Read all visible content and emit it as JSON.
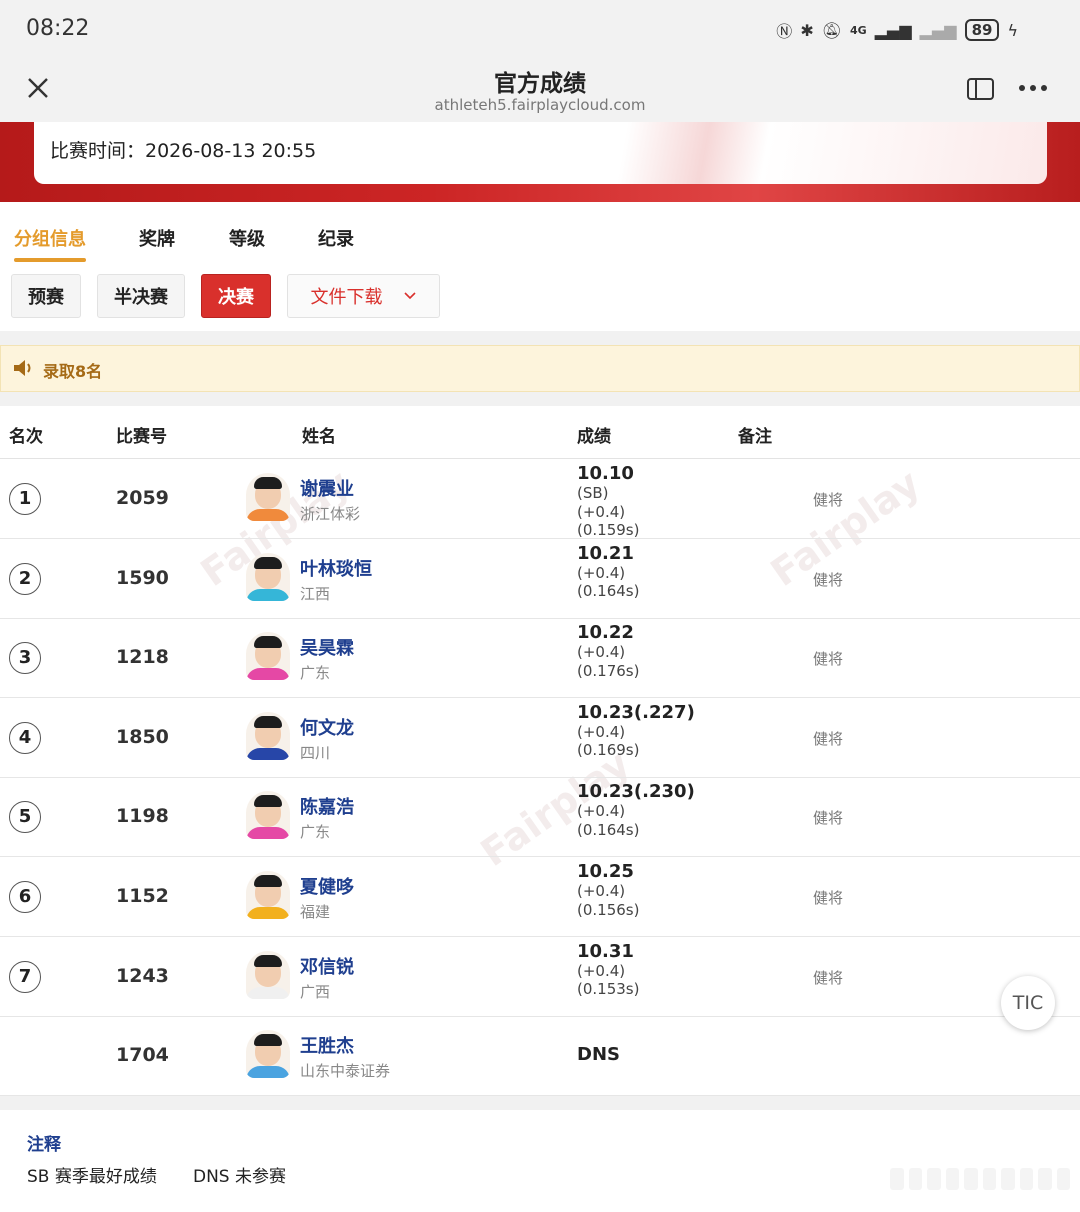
{
  "status_bar": {
    "time": "08:22",
    "network": "4G",
    "battery": "89"
  },
  "browser": {
    "title": "官方成绩",
    "url": "athleteh5.fairplaycloud.com"
  },
  "match_info": {
    "time_label": "比赛时间：2026-08-13  20:55"
  },
  "tabs": [
    {
      "label": "分组信息",
      "active": true
    },
    {
      "label": "奖牌",
      "active": false
    },
    {
      "label": "等级",
      "active": false
    },
    {
      "label": "纪录",
      "active": false
    }
  ],
  "rounds": [
    {
      "label": "预赛",
      "active": false
    },
    {
      "label": "半决赛",
      "active": false
    },
    {
      "label": "决赛",
      "active": true
    }
  ],
  "download_label": "文件下载",
  "notice": "录取8名",
  "table": {
    "headers": [
      "名次",
      "比赛号",
      "姓名",
      "成绩",
      "备注"
    ],
    "rows": [
      {
        "rank": "1",
        "bib": "2059",
        "name": "谢震业",
        "team": "浙江体彩",
        "mark": "10.10",
        "sub": [
          "(SB)",
          "(+0.4)",
          "(0.159s)"
        ],
        "note": "健将",
        "shirt": "#f08a3c"
      },
      {
        "rank": "2",
        "bib": "1590",
        "name": "叶林琰恒",
        "team": "江西",
        "mark": "10.21",
        "sub": [
          "(+0.4)",
          "(0.164s)"
        ],
        "note": "健将",
        "shirt": "#35b6d8"
      },
      {
        "rank": "3",
        "bib": "1218",
        "name": "吴昊霖",
        "team": "广东",
        "mark": "10.22",
        "sub": [
          "(+0.4)",
          "(0.176s)"
        ],
        "note": "健将",
        "shirt": "#e548a5"
      },
      {
        "rank": "4",
        "bib": "1850",
        "name": "何文龙",
        "team": "四川",
        "mark": "10.23(.227)",
        "sub": [
          "(+0.4)",
          "(0.169s)"
        ],
        "note": "健将",
        "shirt": "#2746a8"
      },
      {
        "rank": "5",
        "bib": "1198",
        "name": "陈嘉浩",
        "team": "广东",
        "mark": "10.23(.230)",
        "sub": [
          "(+0.4)",
          "(0.164s)"
        ],
        "note": "健将",
        "shirt": "#e548a5"
      },
      {
        "rank": "6",
        "bib": "1152",
        "name": "夏健哆",
        "team": "福建",
        "mark": "10.25",
        "sub": [
          "(+0.4)",
          "(0.156s)"
        ],
        "note": "健将",
        "shirt": "#f2b01e"
      },
      {
        "rank": "7",
        "bib": "1243",
        "name": "邓信锐",
        "team": "广西",
        "mark": "10.31",
        "sub": [
          "(+0.4)",
          "(0.153s)"
        ],
        "note": "健将",
        "shirt": "#f0f0f0"
      },
      {
        "rank": "",
        "bib": "1704",
        "name": "王胜杰",
        "team": "山东中泰证券",
        "mark": "DNS",
        "sub": [],
        "note": "",
        "shirt": "#4aa3e0"
      }
    ]
  },
  "floating_button": "TIC",
  "footnote": {
    "title": "注释",
    "items": [
      "SB 赛季最好成绩",
      "DNS 未参赛"
    ]
  },
  "colors": {
    "accent": "#e49b2c",
    "brand_red": "#d9302c",
    "name_blue": "#1f3f8f"
  }
}
